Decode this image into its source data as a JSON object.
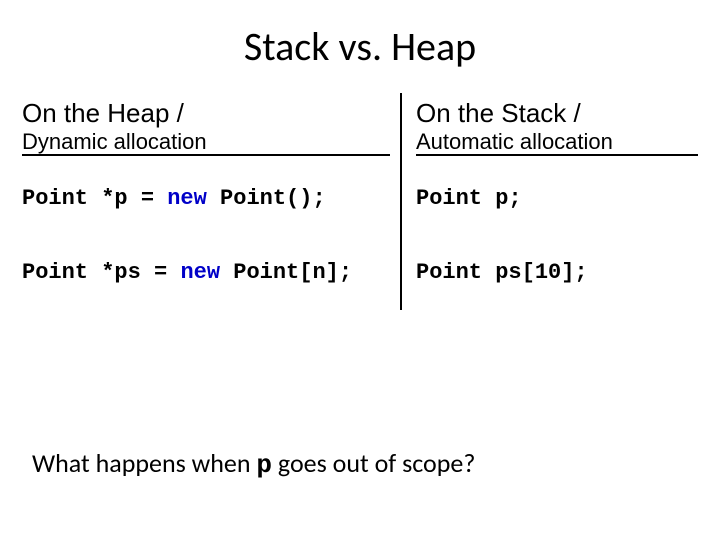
{
  "title": "Stack vs. Heap",
  "headers": {
    "left": {
      "heading": "On the Heap /",
      "sub": "Dynamic allocation"
    },
    "right": {
      "heading": "On the Stack /",
      "sub": "Automatic allocation"
    }
  },
  "rows": [
    {
      "heap_pre": "Point *p = ",
      "heap_kw": "new",
      "heap_post": " Point();",
      "stack": "Point p;"
    },
    {
      "heap_pre": "Point *ps = ",
      "heap_kw": "new",
      "heap_post": " Point[n];",
      "stack": "Point ps[10];"
    }
  ],
  "question": {
    "pre": "What happens when ",
    "code": "p",
    "post": " goes out of scope?"
  }
}
